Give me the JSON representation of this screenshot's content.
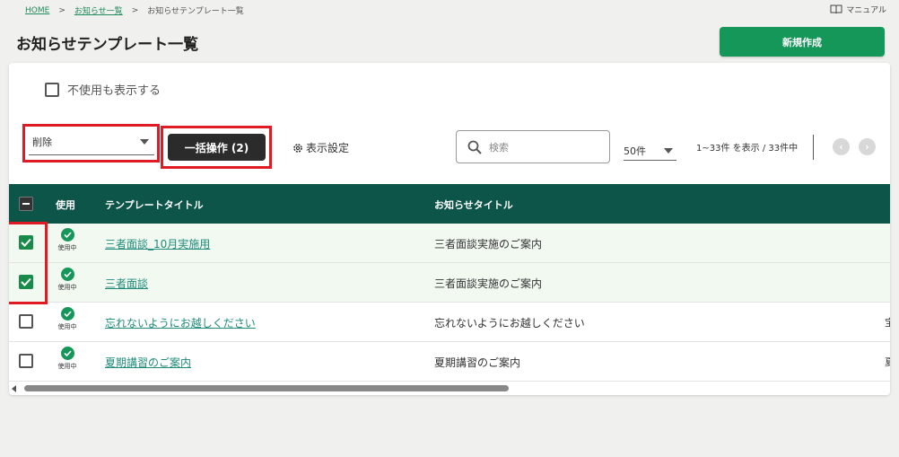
{
  "breadcrumb": {
    "home": "HOME",
    "sep1": ">",
    "notices": "お知らせ一覧",
    "sep2": ">",
    "current": "お知らせテンプレート一覧"
  },
  "manual": {
    "label": "マニュアル",
    "icon": "book-icon"
  },
  "page": {
    "title": "お知らせテンプレート一覧",
    "new_button": "新規作成"
  },
  "filters": {
    "show_unused_label": "不使用も表示する",
    "show_unused_checked": false
  },
  "toolbar": {
    "action_select_value": "削除",
    "bulk_button": "一括操作 (2)",
    "display_settings": "表示設定",
    "search_placeholder": "検索",
    "per_page": "50件",
    "count_text": "1~33件 を表示 / 33件中"
  },
  "table": {
    "headers": {
      "usage": "使用",
      "template_title": "テンプレートタイトル",
      "notice_title": "お知らせタイトル"
    },
    "rows": [
      {
        "checked": true,
        "status": "使用中",
        "template_title": "三者面談_10月実施用",
        "notice_title": "三者面談実施のご案内",
        "trailing": ""
      },
      {
        "checked": true,
        "status": "使用中",
        "template_title": "三者面談",
        "notice_title": "三者面談実施のご案内",
        "trailing": ""
      },
      {
        "checked": false,
        "status": "使用中",
        "template_title": "忘れないようにお越しください",
        "notice_title": "忘れないようにお越しください",
        "trailing": "宝"
      },
      {
        "checked": false,
        "status": "使用中",
        "template_title": "夏期講習のご案内",
        "notice_title": "夏期講習のご案内",
        "trailing": "夏"
      }
    ]
  },
  "colors": {
    "primary_green": "#16975a",
    "table_header": "#0d5449",
    "highlight_red": "#e01b24",
    "bulk_button": "#2b2b2b"
  }
}
